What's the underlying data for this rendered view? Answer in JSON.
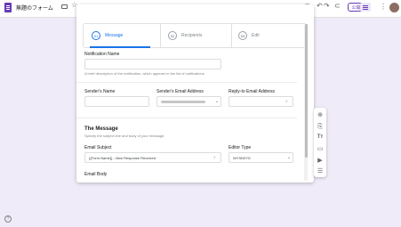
{
  "header": {
    "form_title": "無題のフォーム",
    "publish_label": "公開",
    "icons": [
      "forms-app-icon",
      "folder-icon",
      "star-icon",
      "palette-icon",
      "preview-icon",
      "undo-icon",
      "redo-icon",
      "link-icon",
      "qr-menu-icon",
      "more-vert-icon",
      "avatar"
    ]
  },
  "dialog": {
    "steps": [
      {
        "num": "01",
        "label": "Message"
      },
      {
        "num": "02",
        "label": "Recipients"
      },
      {
        "num": "03",
        "label": "Edit"
      }
    ],
    "notification_name": {
      "label": "Notification Name",
      "value": "",
      "hint": "A brief description of the notification, which appears in the list of notifications"
    },
    "senders_name": {
      "label": "Sender's Name",
      "value": ""
    },
    "senders_email": {
      "label": "Sender's Email Address"
    },
    "reply_to": {
      "label": "Reply-to Email Address",
      "value": ""
    },
    "message": {
      "title": "The Message",
      "subtitle": "Specify the subject line and body of your message.",
      "email_subject_label": "Email Subject",
      "email_subject_value": "{{Form Name}} - New Response Received",
      "editor_type_label": "Editor Type",
      "editor_type_value": "WYSIWYG",
      "email_body_label": "Email Body"
    }
  },
  "side_toolbar": {
    "icons": [
      "add-question-icon",
      "import-questions-icon",
      "title-text-icon",
      "add-image-icon",
      "add-video-icon",
      "add-section-icon"
    ],
    "title_glyph": "Tт"
  },
  "footer": {
    "help_glyph": "?"
  }
}
